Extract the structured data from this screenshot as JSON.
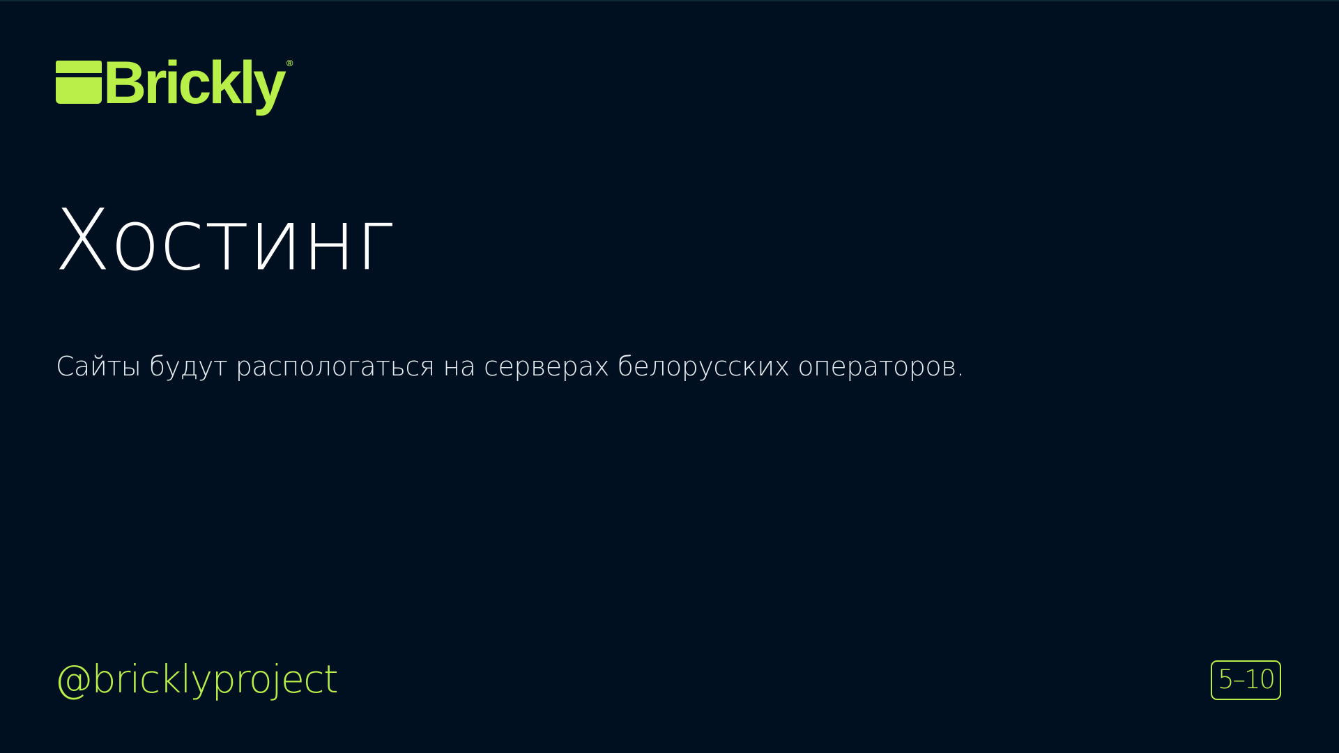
{
  "theme": {
    "background": "#011020",
    "accent": "#b8f049",
    "text": "#ffffff"
  },
  "logo": {
    "icon": "brick-icon",
    "text": "Brickly",
    "registered": "®"
  },
  "slide": {
    "title": "Хостинг",
    "subtitle": "Сайты будут распологаться на серверах белорусских операторов."
  },
  "footer": {
    "handle": "@bricklyproject",
    "page_indicator": "5–10"
  }
}
